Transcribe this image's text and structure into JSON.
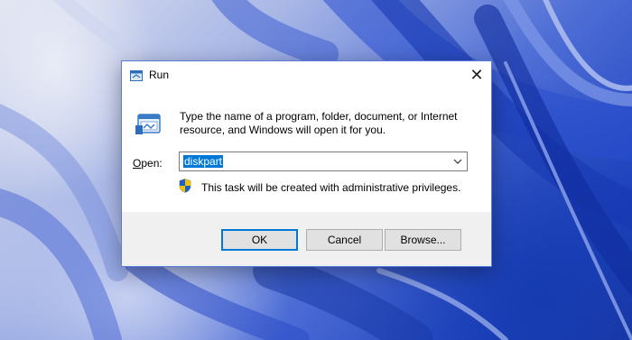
{
  "dialog": {
    "title": "Run",
    "description": "Type the name of a program, folder, document, or Internet resource, and Windows will open it for you.",
    "open_label_underlined": "O",
    "open_label_rest": "pen:",
    "open_value": "diskpart",
    "admin_note": "This task will be created with administrative privileges.",
    "close_symbol": "✕",
    "icons": {
      "title": "run-icon",
      "main": "run-icon",
      "shield": "uac-shield-icon",
      "dropdown": "chevron-down-icon"
    }
  },
  "buttons": {
    "ok": "OK",
    "cancel": "Cancel",
    "browse": "Browse..."
  },
  "colors": {
    "selection": "#0078d7",
    "dialog_border": "#5c7bd8",
    "footer_bg": "#f0f0f0"
  }
}
